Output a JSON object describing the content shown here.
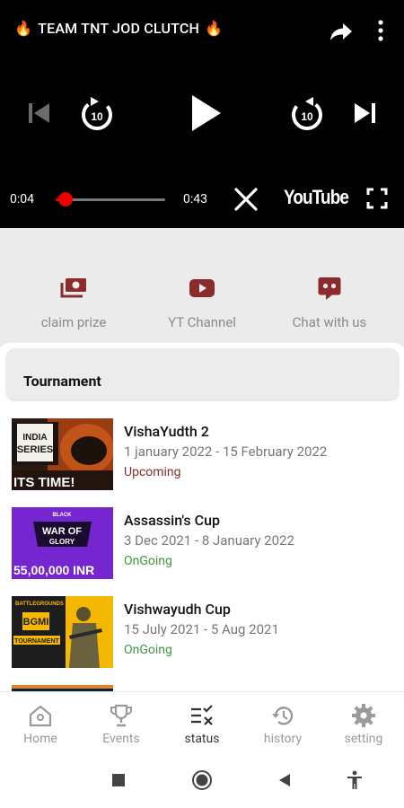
{
  "player": {
    "title": "TEAM TNT JOD CLUTCH",
    "flame_icon": "🔥",
    "current_time": "0:04",
    "duration": "0:43",
    "progress": 0.09,
    "brand": "YouTube",
    "seek_back_seconds": "10",
    "seek_forward_seconds": "10"
  },
  "actions": [
    {
      "label": "claim prize",
      "icon": "money-icon"
    },
    {
      "label": "YT Channel",
      "icon": "youtube-icon"
    },
    {
      "label": "Chat with us",
      "icon": "chat-icon"
    }
  ],
  "section": {
    "title": "Tournament"
  },
  "tournaments": [
    {
      "name": "VishaYudth 2",
      "dates": "1 january 2022 - 15 February 2022",
      "status": "Upcoming",
      "status_color": "#8b2c2c"
    },
    {
      "name": "Assassin's Cup",
      "dates": "3 Dec 2021 - 8 January 2022",
      "status": "OnGoing",
      "status_color": "#3c9a3c"
    },
    {
      "name": "Vishwayudh Cup",
      "dates": "15 July 2021 - 5 Aug 2021",
      "status": "OnGoing",
      "status_color": "#3c9a3c"
    }
  ],
  "thumbnails": {
    "t1": {
      "line1": "INDIA",
      "line2": "SERIES",
      "caption": "ITS TIME!"
    },
    "t2": {
      "top": "BLACK",
      "line1": "WAR OF",
      "line2": "GLORY",
      "caption": "55,00,000 INR"
    },
    "t3": {
      "top": "BATTLEGROUNDS",
      "badge": "BGMI",
      "line2": "TOURNAMENT"
    }
  },
  "bottom_nav": [
    {
      "label": "Home",
      "icon": "home-icon"
    },
    {
      "label": "Events",
      "icon": "trophy-icon"
    },
    {
      "label": "status",
      "icon": "checklist-icon",
      "active": true
    },
    {
      "label": "history",
      "icon": "history-icon"
    },
    {
      "label": "setting",
      "icon": "gear-icon"
    }
  ],
  "colors": {
    "accent_maroon": "#8b2c2c",
    "ongoing_green": "#3c9a3c",
    "seek_red": "#ee0000"
  }
}
